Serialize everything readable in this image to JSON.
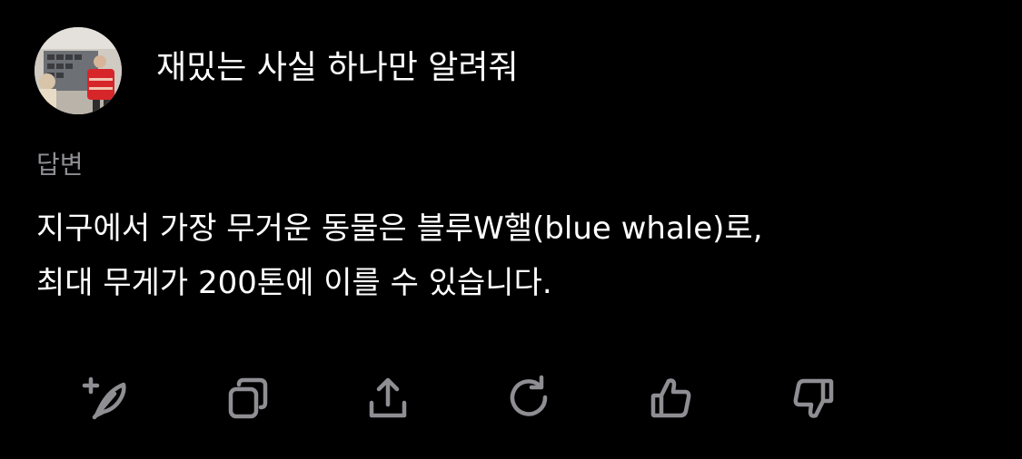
{
  "prompt": {
    "text": "재밌는 사실 하나만 알려줘"
  },
  "answer": {
    "label": "답변",
    "lines": [
      "지구에서 가장 무거운 동물은 블루W핼(blue whale)로,",
      "최대 무게가 200톤에 이를 수 있습니다."
    ]
  },
  "actions": [
    {
      "icon": "feather-plus-icon"
    },
    {
      "icon": "copy-icon"
    },
    {
      "icon": "share-icon"
    },
    {
      "icon": "regenerate-icon"
    },
    {
      "icon": "thumbs-up-icon"
    },
    {
      "icon": "thumbs-down-icon"
    }
  ],
  "colors": {
    "background": "#000000",
    "text": "#ffffff",
    "muted": "#8e8e93"
  }
}
